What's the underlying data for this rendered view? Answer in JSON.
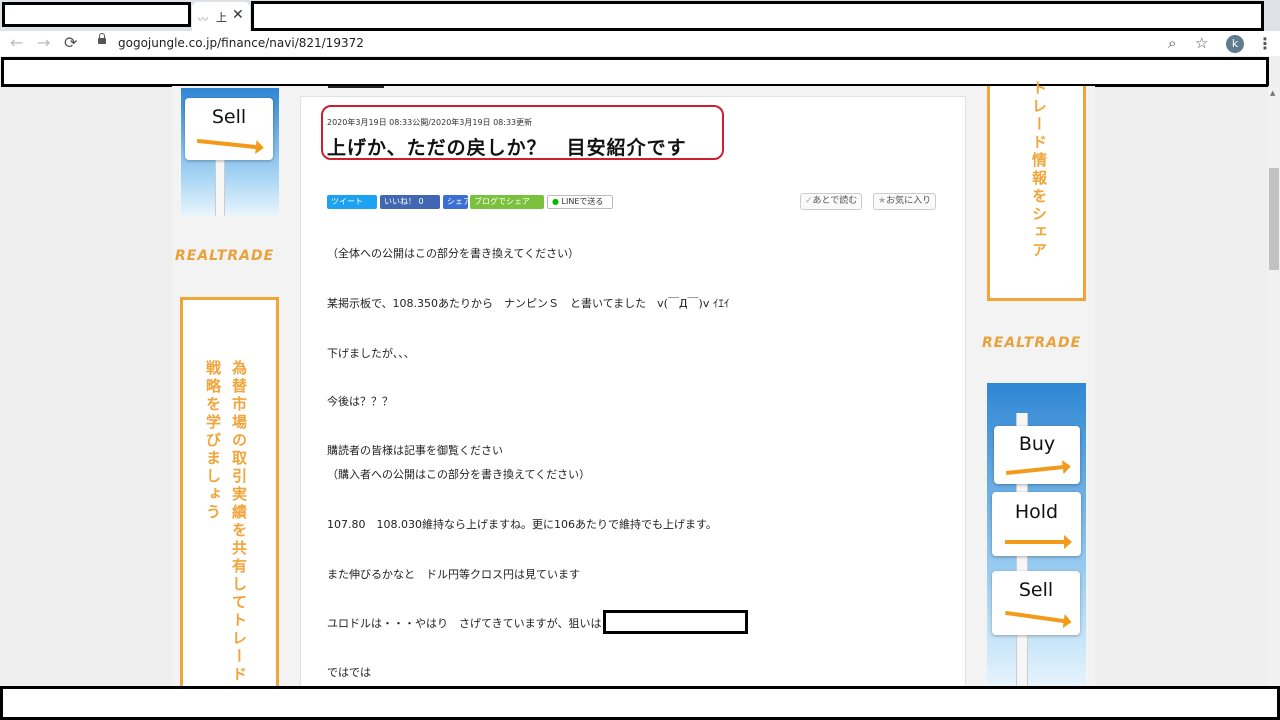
{
  "tab": {
    "title": "上",
    "close": "✕"
  },
  "toolbar": {
    "url": "gogojungle.co.jp/finance/navi/821/19372",
    "avatar_letter": "k"
  },
  "icons": {
    "back": "←",
    "forward": "→",
    "reload": "⟳",
    "zoom": "⌕",
    "star": "☆",
    "menu": "⋮"
  },
  "article": {
    "meta": "2020年3月19日 08:33公開/2020年3月19日 08:33更新",
    "title": "上げか、ただの戻しか？　目安紹介です",
    "share": [
      "ツイート",
      "いいね！ 0",
      "シェア",
      "ブログでシェア",
      "LINEで送る"
    ],
    "read_later": "あとで読む",
    "favorite": "お気に入り",
    "paragraphs": [
      "（全体への公開はこの部分を書き換えてください）",
      "某掲示板で、108.350あたりから　ナンピンＳ　と書いてました　v(￣Д￣)v ｲｴｲ",
      "下げましたが、、、",
      "今後は？？？",
      "購読者の皆様は記事を御覧ください",
      "（購入者への公開はこの部分を書き換えてください）",
      "107.80　108.030維持なら上げますね。更に106あたりで維持でも上げます。",
      "また伸びるかなと　ドル円等クロス円は見ています",
      "ユロドルは・・・やはり　さげてきていますが、狙いは",
      "ではでは"
    ]
  },
  "left_ads": {
    "sign": "Sell",
    "logo": "REALTRADE",
    "vertical_lines": [
      "為替市場の取引実績を共有して",
      "トレード戦略を学びましょう"
    ]
  },
  "right_ads": {
    "vertical_text": "トレード情報をシェア",
    "logo": "REALTRADE",
    "signs": [
      "Buy",
      "Hold",
      "Sell"
    ]
  },
  "colors": {
    "accent_red": "#cc1f2f",
    "brand_orange": "#f0a53a",
    "twitter": "#1da1f2",
    "facebook": "#4267b2",
    "blog": "#7cc13d"
  }
}
